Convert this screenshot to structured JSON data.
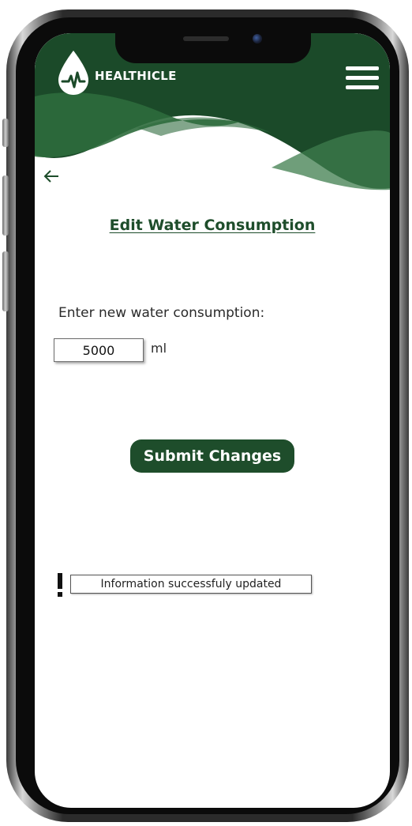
{
  "app": {
    "brand_name": "HEALTHICLE",
    "brand_color": "#1e4d2b",
    "logo_icon": "water-drop-heartbeat-icon",
    "menu_icon": "hamburger-menu-icon"
  },
  "navigation": {
    "back_icon": "arrow-left-icon"
  },
  "page": {
    "title": "Edit Water Consumption"
  },
  "form": {
    "prompt": "Enter new water consumption:",
    "amount_value": "5000",
    "unit": "ml",
    "submit_label": "Submit Changes"
  },
  "status": {
    "icon": "exclamation-icon",
    "message": "Information successfuly updated"
  }
}
